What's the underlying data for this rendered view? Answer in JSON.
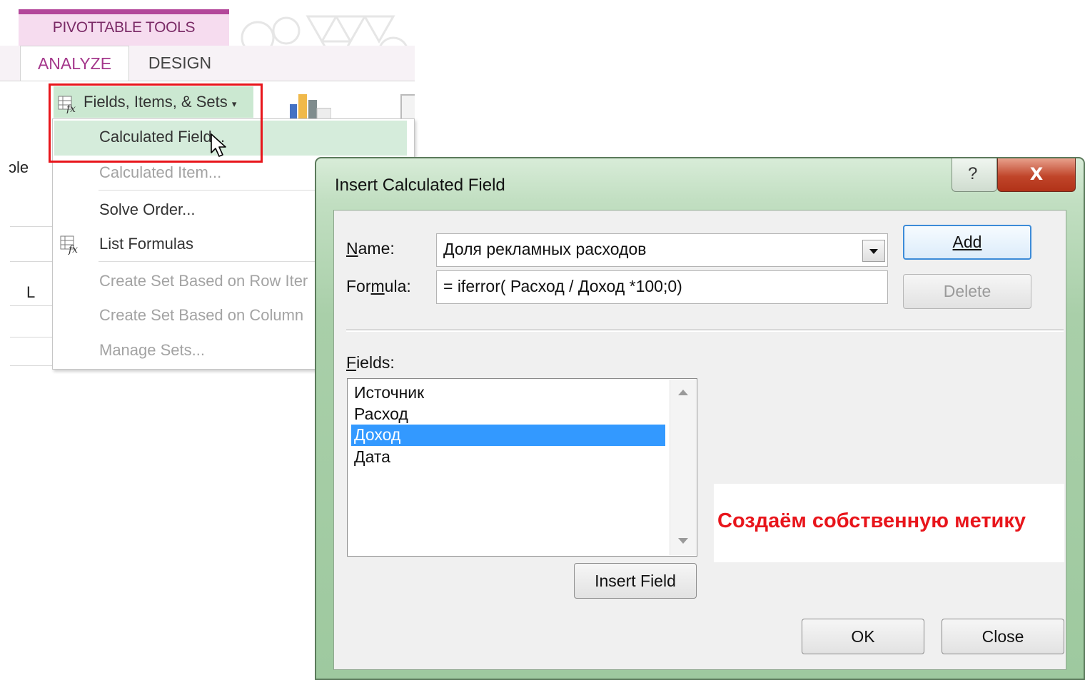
{
  "ribbon": {
    "context_title": "PIVOTTABLE TOOLS",
    "tabs": [
      {
        "label": "ANALYZE",
        "active": true
      },
      {
        "label": "DESIGN",
        "active": false
      }
    ],
    "button_label": "Fields, Items, & Sets",
    "button_icon": "calculated-field-icon",
    "accent_color": "#a4378b"
  },
  "sheet": {
    "partial_label": "ɔle",
    "column_label": "L"
  },
  "menu": {
    "items": [
      {
        "label": "Calculated Field...",
        "enabled": true,
        "highlighted": true
      },
      {
        "label": "Calculated Item...",
        "enabled": false
      },
      {
        "label": "Solve Order...",
        "enabled": true
      },
      {
        "label": "List Formulas",
        "enabled": true,
        "icon": "list-formulas-icon"
      },
      {
        "label": "Create Set Based on Row Iter",
        "enabled": false
      },
      {
        "label": "Create Set Based on Column",
        "enabled": false
      },
      {
        "label": "Manage Sets...",
        "enabled": false
      }
    ]
  },
  "dialog": {
    "title": "Insert Calculated Field",
    "name_label": "Name:",
    "name_value": "Доля рекламных расходов",
    "formula_label": "Formula:",
    "formula_value": "= iferror( Расход / Доход *100;0)",
    "add_label": "Add",
    "delete_label": "Delete",
    "fields_label": "Fields:",
    "fields": [
      "Источник",
      "Расход",
      "Доход",
      "Дата"
    ],
    "selected_field": "Доход",
    "insert_field_label": "Insert Field",
    "ok_label": "OK",
    "close_label": "Close",
    "help_glyph": "?",
    "close_glyph": "X"
  },
  "annotation": {
    "text": "Создаём собственную метику",
    "color": "#e8151b"
  }
}
